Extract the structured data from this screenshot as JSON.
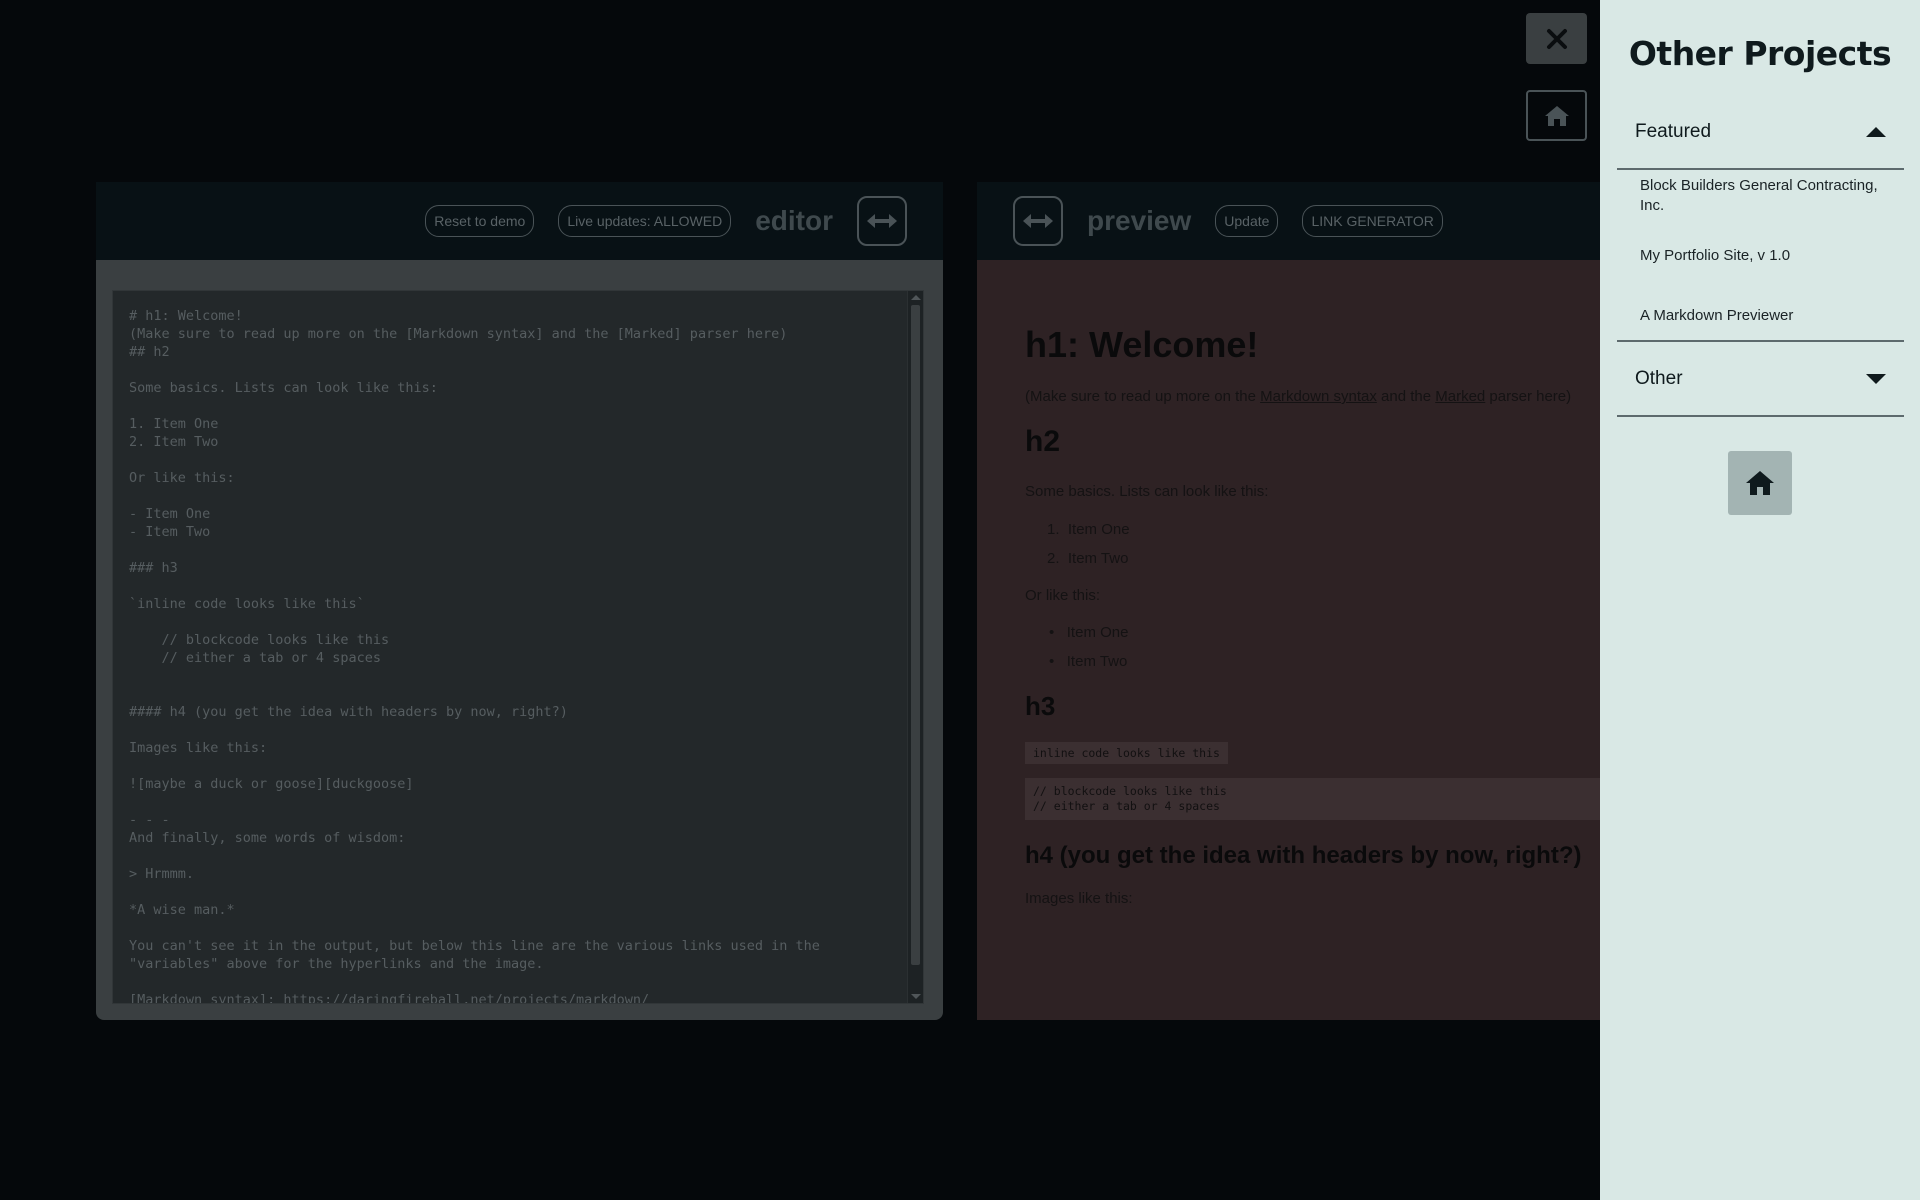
{
  "editor_toolbar": {
    "reset_label": "Reset to demo",
    "live_label": "Live updates: ALLOWED",
    "title": "editor"
  },
  "preview_toolbar": {
    "title": "preview",
    "update_label": "Update",
    "link_gen_label": "LINK GENERATOR"
  },
  "editor": {
    "content": "# h1: Welcome!\n(Make sure to read up more on the [Markdown syntax] and the [Marked] parser here)\n## h2\n\nSome basics. Lists can look like this:\n\n1. Item One\n2. Item Two\n\nOr like this:\n\n- Item One\n- Item Two\n\n### h3\n\n`inline code looks like this`\n\n    // blockcode looks like this\n    // either a tab or 4 spaces\n\n\n#### h4 (you get the idea with headers by now, right?)\n\nImages like this:\n\n![maybe a duck or goose][duckgoose]\n\n- - -\nAnd finally, some words of wisdom:\n\n> Hrmmm.\n\n*A wise man.*\n\nYou can't see it in the output, but below this line are the various links used in the\n\"variables\" above for the hyperlinks and the image.\n\n[Markdown syntax]: https://daringfireball.net/projects/markdown/"
  },
  "preview": {
    "h1": "h1: Welcome!",
    "intro_before": "(Make sure to read up more on the ",
    "link1": "Markdown syntax",
    "intro_mid": " and the ",
    "link2": "Marked",
    "intro_after": " parser here)",
    "h2": "h2",
    "basics": "Some basics. Lists can look like this:",
    "ol": [
      "Item One",
      "Item Two"
    ],
    "or_like": "Or like this:",
    "ul": [
      "Item One",
      "Item Two"
    ],
    "h3": "h3",
    "inline_code": "inline code looks like this",
    "block_code": "// blockcode looks like this\n// either a tab or 4 spaces",
    "h4": "h4 (you get the idea with headers by now, right?)",
    "images": "Images like this:"
  },
  "drawer": {
    "title": "Other Projects",
    "featured_label": "Featured",
    "featured_items": [
      "Block Builders General Contracting, Inc.",
      "My Portfolio Site, v 1.0",
      "A Markdown Previewer"
    ],
    "other_label": "Other"
  },
  "icons": {
    "close": "close-icon",
    "home": "home-icon",
    "expand": "horizontal-arrows-icon",
    "caret_up": "caret-up-icon",
    "caret_down": "caret-down-icon"
  },
  "colors": {
    "drawer_bg": "#d9e8e5",
    "overlay_bg": "#05080b",
    "preview_bg": "#2e2224"
  }
}
